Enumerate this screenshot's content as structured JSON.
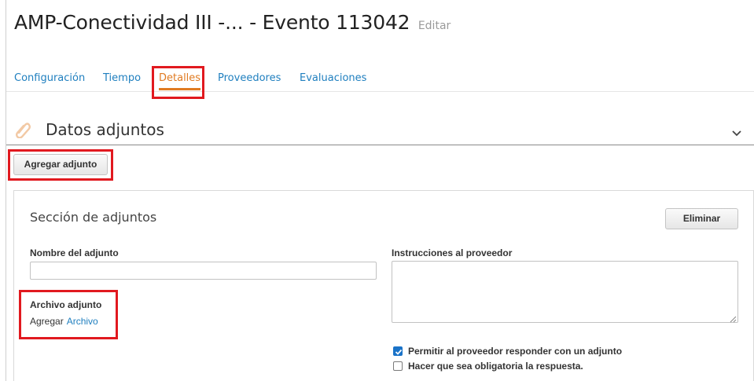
{
  "header": {
    "title": "AMP-Conectividad III -... - Evento 113042",
    "edit_label": "Editar"
  },
  "tabs": [
    {
      "label": "Configuración",
      "active": false
    },
    {
      "label": "Tiempo",
      "active": false
    },
    {
      "label": "Detalles",
      "active": true
    },
    {
      "label": "Proveedores",
      "active": false
    },
    {
      "label": "Evaluaciones",
      "active": false
    }
  ],
  "section": {
    "title": "Datos adjuntos",
    "icon": "paperclip-icon",
    "collapse_icon": "chevron-down-icon"
  },
  "toolbar": {
    "add_attachment_label": "Agregar adjunto"
  },
  "attachment_panel": {
    "title": "Sección de adjuntos",
    "delete_label": "Eliminar",
    "name_label": "Nombre del adjunto",
    "name_value": "",
    "instructions_label": "Instrucciones al proveedor",
    "instructions_value": "",
    "file_label": "Archivo adjunto",
    "file_add_text": "Agregar",
    "file_link_text": "Archivo",
    "options": [
      {
        "label": "Permitir al proveedor responder con un adjunto",
        "checked": true
      },
      {
        "label": "Hacer que sea obligatoria la respuesta.",
        "checked": false
      }
    ]
  },
  "colors": {
    "accent_orange": "#e07b22",
    "link_blue": "#1f7fbf",
    "highlight_red": "#e1191f",
    "checkbox_blue": "#1a73c8"
  }
}
